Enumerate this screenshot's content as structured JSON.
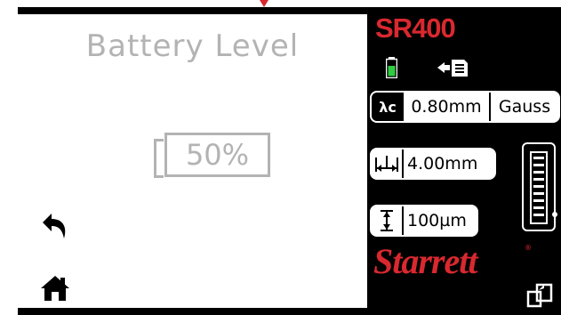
{
  "screen": {
    "title": "Battery Level",
    "battery_percent_label": "50%",
    "battery_level": 0.5
  },
  "header": {
    "model": "SR400"
  },
  "status": {
    "battery_icon": "battery-icon",
    "battery_color": "#2ecc40",
    "storage_icon": "memory-card-icon"
  },
  "settings": {
    "cutoff_symbol": "λc",
    "cutoff_value": "0.80mm",
    "filter": "Gauss",
    "length_icon": "traverse-length-icon",
    "length_value": "4.00mm",
    "range_icon": "measuring-range-icon",
    "range_value": "100µm"
  },
  "brand": {
    "name": "Starrett",
    "color": "#d9282f"
  },
  "nav": {
    "back_icon": "back-arrow-icon",
    "home_icon": "home-icon",
    "export_icon": "export-icon"
  }
}
